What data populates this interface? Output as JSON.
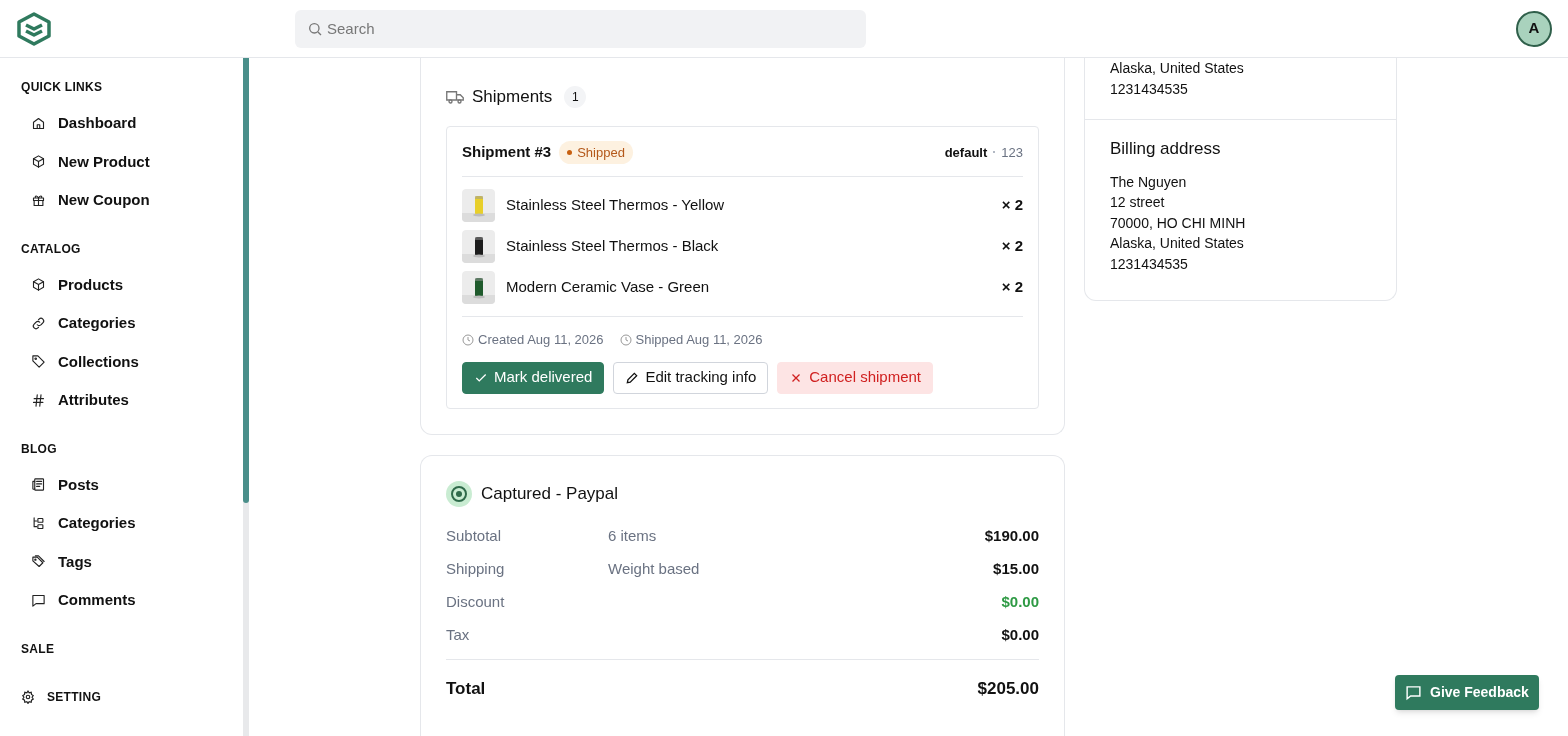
{
  "search": {
    "placeholder": "Search"
  },
  "avatar": {
    "initial": "A"
  },
  "sidebar": {
    "sections": [
      {
        "title": "QUICK LINKS",
        "items": [
          {
            "label": "Dashboard"
          },
          {
            "label": "New Product"
          },
          {
            "label": "New Coupon"
          }
        ]
      },
      {
        "title": "CATALOG",
        "items": [
          {
            "label": "Products"
          },
          {
            "label": "Categories"
          },
          {
            "label": "Collections"
          },
          {
            "label": "Attributes"
          }
        ]
      },
      {
        "title": "BLOG",
        "items": [
          {
            "label": "Posts"
          },
          {
            "label": "Categories"
          },
          {
            "label": "Tags"
          },
          {
            "label": "Comments"
          }
        ]
      },
      {
        "title": "SALE"
      }
    ],
    "footer": {
      "label": "SETTING"
    }
  },
  "shipments": {
    "title": "Shipments",
    "count": "1",
    "shipment": {
      "title": "Shipment #3",
      "status": "Shipped",
      "method": "default",
      "tracking": "123",
      "items": [
        {
          "name": "Stainless Steel Thermos - Yellow",
          "qty": "× 2"
        },
        {
          "name": "Stainless Steel Thermos - Black",
          "qty": "× 2"
        },
        {
          "name": "Modern Ceramic Vase - Green",
          "qty": "× 2"
        }
      ],
      "created": "Created Aug 11, 2026",
      "shipped": "Shipped Aug 11, 2026",
      "actions": [
        {
          "label": "Mark delivered",
          "kind": "primary"
        },
        {
          "label": "Edit tracking info",
          "kind": "outline"
        },
        {
          "label": "Cancel shipment",
          "kind": "danger"
        }
      ]
    }
  },
  "payment": {
    "title": "Captured - Paypal",
    "rows": [
      {
        "label": "Subtotal",
        "detail": "6 items",
        "amount": "$190.00",
        "kind": "normal"
      },
      {
        "label": "Shipping",
        "detail": "Weight based",
        "amount": "$15.00",
        "kind": "normal"
      },
      {
        "label": "Discount",
        "amount": "$0.00",
        "kind": "discount"
      },
      {
        "label": "Tax",
        "amount": "$0.00",
        "kind": "normal"
      }
    ],
    "total": {
      "label": "Total",
      "amount": "$205.00"
    }
  },
  "shipping_address_tail": [
    "Alaska, United States",
    "1231434535"
  ],
  "billing_address": {
    "title": "Billing address",
    "lines": [
      "The Nguyen",
      "12 street",
      "70000, HO CHI MINH",
      "Alaska, United States",
      "1231434535"
    ]
  },
  "feedback_button": {
    "label": "Give Feedback"
  }
}
